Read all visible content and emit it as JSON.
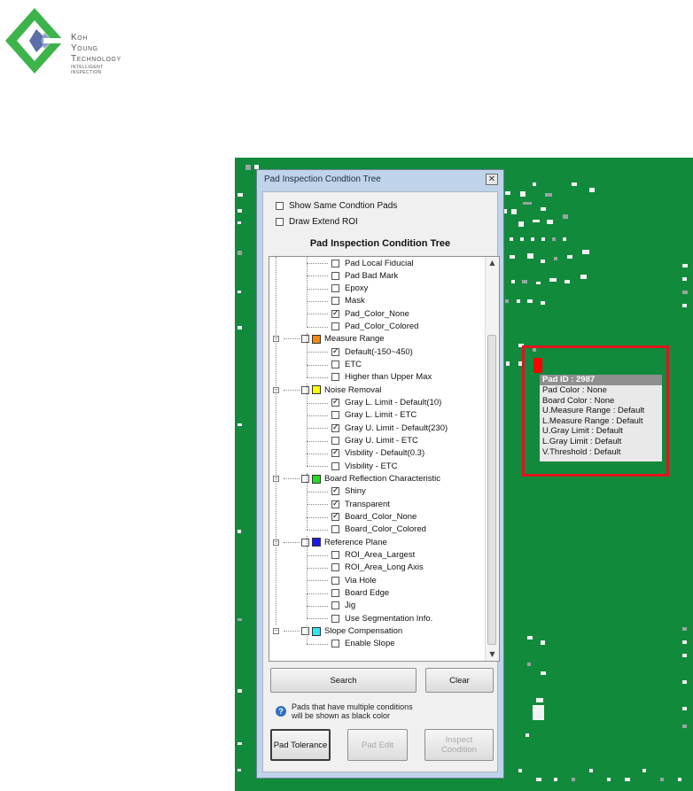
{
  "logo": {
    "line1": "Koh",
    "line2": "Young",
    "line3": "Technology",
    "line4": "INTELLIGENT",
    "line5": "INSPECTION"
  },
  "tooltip": {
    "title": "Pad ID : 2987",
    "lines": [
      "Pad Color : None",
      "Board Color : None",
      "U.Measure Range : Default",
      "L.Measure Range : Default",
      "U.Gray Limit : Default",
      "L.Gray Limit : Default",
      "V.Threshold : Default"
    ]
  },
  "dialog": {
    "title": "Pad Inspection Condtion Tree",
    "close_glyph": "✕",
    "options": [
      {
        "label": "Show Same Condtion Pads",
        "checked": false
      },
      {
        "label": "Draw Extend ROI",
        "checked": false
      }
    ],
    "tree_title": "Pad Inspection Condition Tree",
    "tree": [
      {
        "kind": "leaf",
        "label": "Pad Local Fiducial",
        "checked": false
      },
      {
        "kind": "leaf",
        "label": "Pad Bad Mark",
        "checked": false
      },
      {
        "kind": "leaf",
        "label": "Epoxy",
        "checked": false
      },
      {
        "kind": "leaf",
        "label": "Mask",
        "checked": false
      },
      {
        "kind": "leaf",
        "label": "Pad_Color_None",
        "checked": true
      },
      {
        "kind": "leaf",
        "label": "Pad_Color_Colored",
        "checked": false
      },
      {
        "kind": "parent",
        "label": "Measure Range",
        "color": "#f28a12"
      },
      {
        "kind": "leaf",
        "label": "Default(-150~450)",
        "checked": true
      },
      {
        "kind": "leaf",
        "label": "ETC",
        "checked": false
      },
      {
        "kind": "leaf",
        "label": "Higher than Upper Max",
        "checked": false
      },
      {
        "kind": "parent",
        "label": "Noise Removal",
        "color": "#ffff00"
      },
      {
        "kind": "leaf",
        "label": "Gray L. Limit - Default(10)",
        "checked": true
      },
      {
        "kind": "leaf",
        "label": "Gray L. Limit - ETC",
        "checked": false
      },
      {
        "kind": "leaf",
        "label": "Gray U. Limit - Default(230)",
        "checked": true
      },
      {
        "kind": "leaf",
        "label": "Gray U. Limit - ETC",
        "checked": false
      },
      {
        "kind": "leaf",
        "label": "Visbility - Default(0.3)",
        "checked": true
      },
      {
        "kind": "leaf",
        "label": "Visbility - ETC",
        "checked": false
      },
      {
        "kind": "parent",
        "label": "Board Reflection Characteristic",
        "color": "#22dd22"
      },
      {
        "kind": "leaf",
        "label": "Shiny",
        "checked": true
      },
      {
        "kind": "leaf",
        "label": "Transparent",
        "checked": true
      },
      {
        "kind": "leaf",
        "label": "Board_Color_None",
        "checked": true
      },
      {
        "kind": "leaf",
        "label": "Board_Color_Colored",
        "checked": false
      },
      {
        "kind": "parent",
        "label": "Reference Plane",
        "color": "#1a1aee"
      },
      {
        "kind": "leaf",
        "label": "ROI_Area_Largest",
        "checked": false
      },
      {
        "kind": "leaf",
        "label": "ROI_Area_Long Axis",
        "checked": false
      },
      {
        "kind": "leaf",
        "label": "Via Hole",
        "checked": false
      },
      {
        "kind": "leaf",
        "label": "Board Edge",
        "checked": false
      },
      {
        "kind": "leaf",
        "label": "Jig",
        "checked": false
      },
      {
        "kind": "leaf",
        "label": "Use Segmentation Info.",
        "checked": false
      },
      {
        "kind": "parent",
        "label": "Slope Compensation",
        "color": "#33e4ee"
      },
      {
        "kind": "leaf",
        "label": "Enable Slope",
        "checked": false
      }
    ],
    "search_label": "Search",
    "clear_label": "Clear",
    "info_line1": "Pads that have multiple conditions",
    "info_line2": "will be shown as black color",
    "info_icon": "?",
    "pad_tolerance_label": "Pad Tolerance",
    "pad_edit_label": "Pad Edit",
    "inspect_condition_line1": "Inspect",
    "inspect_condition_line2": "Condition",
    "scroll_up": "▲",
    "scroll_down": "▼",
    "expander_glyph": "−"
  }
}
